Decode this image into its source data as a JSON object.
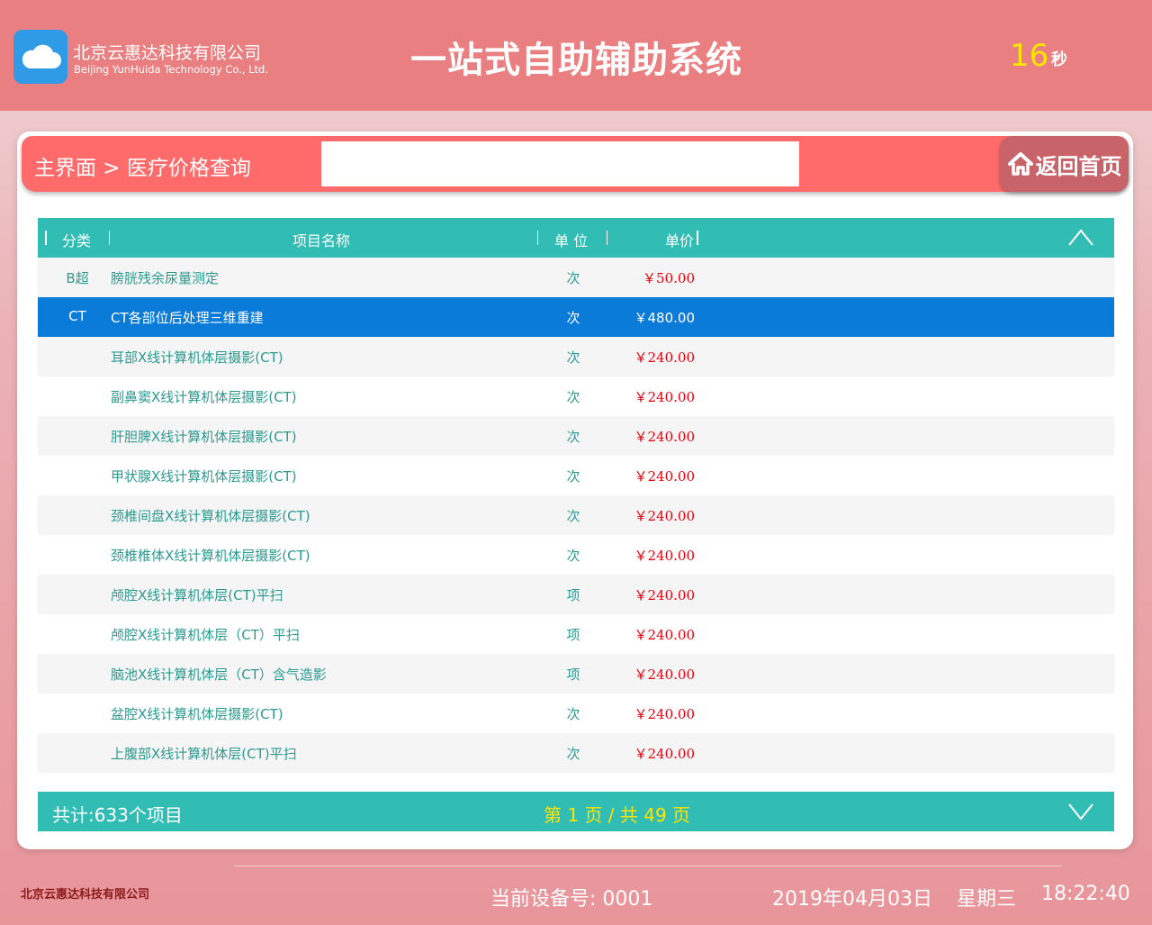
{
  "header": {
    "company_cn": "北京云惠达科技有限公司",
    "company_en": "Beijing YunHuida Technology Co., Ltd.",
    "title": "一站式自助辅助系统",
    "countdown": "16",
    "countdown_unit": "秒"
  },
  "nav": {
    "breadcrumb": "主界面 > 医疗价格查询",
    "search_value": "",
    "home_label": "返回首页"
  },
  "table": {
    "headers": {
      "category": "分类",
      "name": "项目名称",
      "unit": "单 位",
      "price": "单价"
    },
    "rows": [
      {
        "category": "B超",
        "name": "膀胱残余尿量测定",
        "unit": "次",
        "price": "￥50.00"
      },
      {
        "category": "CT",
        "name": "CT各部位后处理三维重建",
        "unit": "次",
        "price": "￥480.00"
      },
      {
        "category": "",
        "name": "耳部X线计算机体层摄影(CT)",
        "unit": "次",
        "price": "￥240.00"
      },
      {
        "category": "",
        "name": "副鼻窦X线计算机体层摄影(CT)",
        "unit": "次",
        "price": "￥240.00"
      },
      {
        "category": "",
        "name": "肝胆脾X线计算机体层摄影(CT)",
        "unit": "次",
        "price": "￥240.00"
      },
      {
        "category": "",
        "name": "甲状腺X线计算机体层摄影(CT)",
        "unit": "次",
        "price": "￥240.00"
      },
      {
        "category": "",
        "name": "颈椎间盘X线计算机体层摄影(CT)",
        "unit": "次",
        "price": "￥240.00"
      },
      {
        "category": "",
        "name": "颈椎椎体X线计算机体层摄影(CT)",
        "unit": "次",
        "price": "￥240.00"
      },
      {
        "category": "",
        "name": "颅腔X线计算机体层(CT)平扫",
        "unit": "项",
        "price": "￥240.00"
      },
      {
        "category": "",
        "name": "颅腔X线计算机体层（CT）平扫",
        "unit": "项",
        "price": "￥240.00"
      },
      {
        "category": "",
        "name": "脑池X线计算机体层（CT）含气造影",
        "unit": "项",
        "price": "￥240.00"
      },
      {
        "category": "",
        "name": "盆腔X线计算机体层摄影(CT)",
        "unit": "次",
        "price": "￥240.00"
      },
      {
        "category": "",
        "name": "上腹部X线计算机体层(CT)平扫",
        "unit": "次",
        "price": "￥240.00"
      }
    ]
  },
  "footer": {
    "total": "共计:633个项目",
    "pager": "第 1 页 / 共 49 页"
  },
  "status": {
    "company": "北京云惠达科技有限公司",
    "device": "当前设备号: 0001",
    "date": "2019年04月03日",
    "weekday": "星期三",
    "time": "18:22:40"
  },
  "colors": {
    "header_bg": "#e97f80",
    "nav_bg": "#ff6b6b",
    "table_header_bg": "#32bdb4",
    "selected_row": "#0a7bd8",
    "price_red": "#e8000e",
    "highlight_yellow": "#ffe400"
  },
  "icons": [
    "cloud-logo-icon",
    "home-icon",
    "chevron-up-icon",
    "chevron-down-icon"
  ]
}
